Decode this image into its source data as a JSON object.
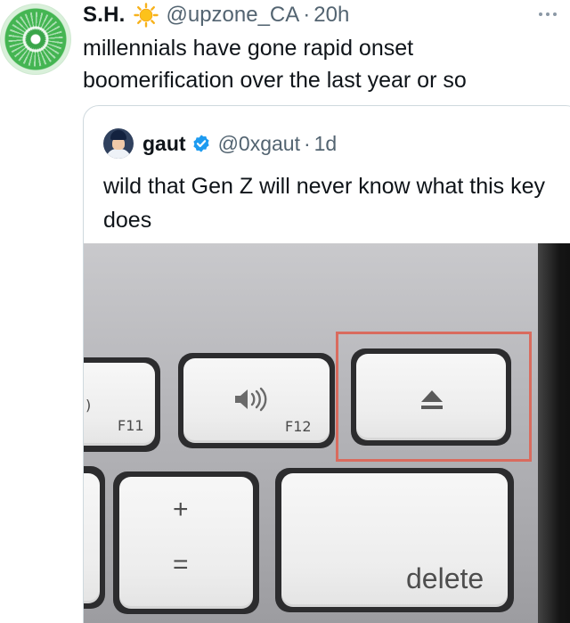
{
  "tweet": {
    "author_name": "S.H.",
    "author_emoji": "sun-emoji",
    "handle": "@upzone_CA",
    "separator": "·",
    "time": "20h",
    "text": "millennials have gone rapid onset boomerification over the last year or so"
  },
  "quoted_tweet": {
    "author_name": "gaut",
    "verified_icon": "verified-badge-icon",
    "handle": "@0xgaut",
    "separator": "·",
    "time": "1d",
    "text": "wild that Gen Z will never know what this key does"
  },
  "photo": {
    "key_labels": {
      "f11": "F11",
      "f12": "F12",
      "plus": "+",
      "equals": "=",
      "delete": "delete",
      "partial_left": ")"
    },
    "highlight_color": "#d96b5e"
  },
  "colors": {
    "text_primary": "#0f1419",
    "text_secondary": "#536471",
    "verified_blue": "#1d9bf0",
    "border": "#cfd9de"
  }
}
